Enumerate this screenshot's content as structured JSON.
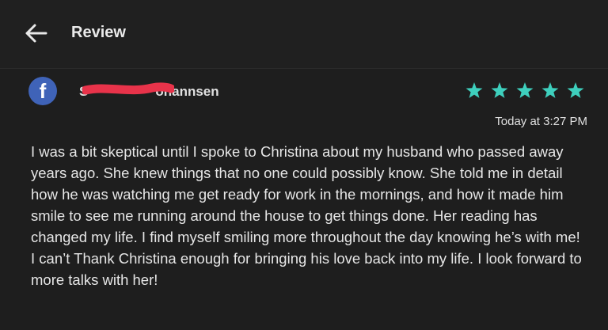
{
  "header": {
    "title": "Review",
    "back_icon": "arrow-left-icon"
  },
  "review": {
    "source_icon": "facebook-icon",
    "source_glyph": "f",
    "reviewer_name": "S                  ohannsen",
    "rating": 5,
    "max_rating": 5,
    "star_color": "#3ecfbd",
    "timestamp": "Today at 3:27 PM",
    "text": "I was a bit skeptical until I spoke to Christina about my husband who passed away years ago. She knew things that no one could possibly know. She told me in detail how he was watching me get ready for work in the mornings, and how it made him smile to see me running around the house to get things done. Her reading has changed my life. I find myself smiling more throughout the day knowing he’s with me! I can’t Thank Christina enough for bringing his love back into my life. I look forward to more talks with her!"
  },
  "colors": {
    "background": "#1e1e1e",
    "facebook_blue": "#3f63b8",
    "redaction": "#e8334a"
  }
}
